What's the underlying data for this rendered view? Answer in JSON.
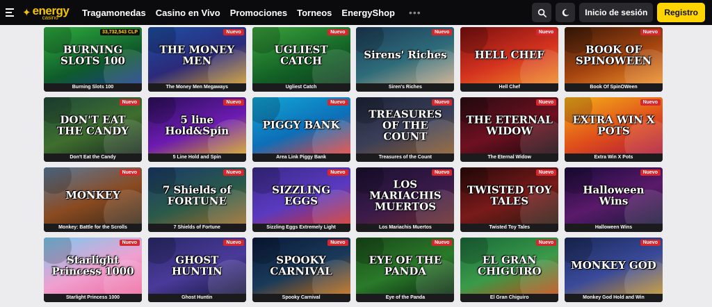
{
  "header": {
    "logo_main": "energy",
    "logo_sub": "casino",
    "nav": [
      "Tragamonedas",
      "Casino en Vivo",
      "Promociones",
      "Torneos",
      "EnergyShop"
    ],
    "more": "•••",
    "login": "Inicio de sesión",
    "register": "Registro",
    "accent": "#ffd400"
  },
  "games": [
    {
      "title": "Burning Slots 100",
      "art": "BURNING SLOTS 100",
      "badge": "",
      "jackpot": "33,732,543 CLP",
      "bg": "linear-gradient(160deg,#2fae3e,#0f5b2b 60%,#1b3e8a)"
    },
    {
      "title": "The Money Men Megaways",
      "art": "THE MONEY MEN",
      "badge": "Nuevo",
      "jackpot": "",
      "bg": "linear-gradient(160deg,#1d4fa3,#2c2a7a 55%,#c9962b)"
    },
    {
      "title": "Ugliest Catch",
      "art": "UGLIEST CATCH",
      "badge": "Nuevo",
      "jackpot": "",
      "bg": "linear-gradient(160deg,#3aa33b,#136226 60%,#0f3c20)"
    },
    {
      "title": "Siren's Riches",
      "art": "Sirens' Riches",
      "badge": "Nuevo",
      "jackpot": "",
      "bg": "linear-gradient(160deg,#1c3a56,#2e6c7a 55%,#c6a98a)"
    },
    {
      "title": "Hell Chef",
      "art": "HELL CHEF",
      "badge": "Nuevo",
      "jackpot": "",
      "bg": "linear-gradient(160deg,#7a0f0f,#d4331f 55%,#f08a24)"
    },
    {
      "title": "Book Of SpinOWeen",
      "art": "BOOK OF SPINOWEEN",
      "badge": "Nuevo",
      "jackpot": "",
      "bg": "linear-gradient(160deg,#3b1a08,#a5440f 55%,#f0902a)"
    },
    {
      "title": "Don't Eat the Candy",
      "art": "DON'T EAT THE CANDY",
      "badge": "Nuevo",
      "jackpot": "",
      "bg": "linear-gradient(160deg,#1f4a3a,#3f6e2e 55%,#1a2c20)"
    },
    {
      "title": "5 Line Hold and Spin",
      "art": "5 line Hold&Spin",
      "badge": "Nuevo",
      "jackpot": "",
      "bg": "linear-gradient(160deg,#2a0f5a,#6c1bb0 55%,#d0a020)"
    },
    {
      "title": "Area Link Piggy Bank",
      "art": "PIGGY BANK",
      "badge": "Nuevo",
      "jackpot": "",
      "bg": "linear-gradient(160deg,#12a6d6,#0d6fb8 55%,#e8403a)"
    },
    {
      "title": "Treasures of the Count",
      "art": "TREASURES OF THE COUNT",
      "badge": "Nuevo",
      "jackpot": "",
      "bg": "linear-gradient(160deg,#1b2438,#3c3f58 55%,#8a5a2a)"
    },
    {
      "title": "The Eternal Widow",
      "art": "THE ETERNAL WIDOW",
      "badge": "Nuevo",
      "jackpot": "",
      "bg": "linear-gradient(160deg,#2a0c12,#6e1020 55%,#1a0a10)"
    },
    {
      "title": "Extra Win X Pots",
      "art": "EXTRA WIN X POTS",
      "badge": "Nuevo",
      "jackpot": "",
      "bg": "linear-gradient(160deg,#f4b01a,#e0501a 55%,#b01a3a)"
    },
    {
      "title": "Monkey: Battle for the Scrolls",
      "art": "MONKEY",
      "badge": "Nuevo",
      "jackpot": "",
      "bg": "linear-gradient(160deg,#5a7a9a,#8a4a20 55%,#3a2a1a)"
    },
    {
      "title": "7 Shields of Fortune",
      "art": "7 Shields of FORTUNE",
      "badge": "Nuevo",
      "jackpot": "",
      "bg": "linear-gradient(160deg,#1a3a6a,#2a5a4a 55%,#9a6a2a)"
    },
    {
      "title": "Sizzling Eggs Extremely Light",
      "art": "SIZZLING EGGS",
      "badge": "Nuevo",
      "jackpot": "",
      "bg": "linear-gradient(160deg,#3a2a8a,#5a3ac0 55%,#d0302a)"
    },
    {
      "title": "Los Mariachis Muertos",
      "art": "LOS MARIACHIS MUERTOS",
      "badge": "Nuevo",
      "jackpot": "",
      "bg": "linear-gradient(160deg,#1a1030,#3a1a4a 55%,#6a2a2a)"
    },
    {
      "title": "Twisted Toy Tales",
      "art": "TWISTED TOY TALES",
      "badge": "Nuevo",
      "jackpot": "",
      "bg": "linear-gradient(160deg,#2a0a0a,#7a1a1a 55%,#2a1a10)"
    },
    {
      "title": "Halloween Wins",
      "art": "Halloween Wins",
      "badge": "Nuevo",
      "jackpot": "",
      "bg": "linear-gradient(160deg,#1a0a3a,#5a1a6a 55%,#1a1a3a)"
    },
    {
      "title": "Starlight Princess 1000",
      "art": "Starlight Princess 1000",
      "badge": "Nuevo",
      "jackpot": "",
      "bg": "linear-gradient(160deg,#7ac8f0,#f0a0d0 55%,#f06aa0)"
    },
    {
      "title": "Ghost Huntin",
      "art": "GHOST HUNTIN",
      "badge": "Nuevo",
      "jackpot": "",
      "bg": "linear-gradient(160deg,#2a2a6a,#4a3a9a 55%,#1a1a40)"
    },
    {
      "title": "Spooky Carnival",
      "art": "SPOOKY CARNIVAL",
      "badge": "Nuevo",
      "jackpot": "",
      "bg": "linear-gradient(160deg,#0a1a3a,#1a3a5a 55%,#c06a10)"
    },
    {
      "title": "Eye of the Panda",
      "art": "EYE OF THE PANDA",
      "badge": "Nuevo",
      "jackpot": "",
      "bg": "linear-gradient(160deg,#1a4a1a,#2a7a2a 55%,#0a2a10)"
    },
    {
      "title": "El Gran Chiguiro",
      "art": "EL GRAN CHIGUIRO",
      "badge": "Nuevo",
      "jackpot": "",
      "bg": "linear-gradient(160deg,#1a6a3a,#3a9a4a 55%,#c04a10)"
    },
    {
      "title": "Monkey God Hold and Win",
      "art": "MONKEY GOD",
      "badge": "Nuevo",
      "jackpot": "",
      "bg": "linear-gradient(160deg,#1a2a5a,#3a4a9a 55%,#c0902a)"
    }
  ]
}
